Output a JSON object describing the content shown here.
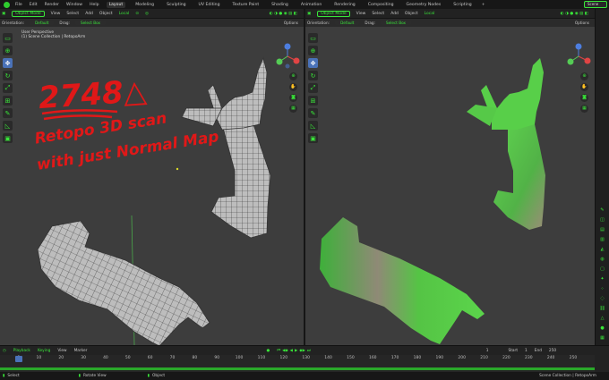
{
  "topbar": {
    "menus": [
      "File",
      "Edit",
      "Render",
      "Window",
      "Help"
    ],
    "workspaces": [
      "Layout",
      "Modeling",
      "Sculpting",
      "UV Editing",
      "Texture Paint",
      "Shading",
      "Animation",
      "Rendering",
      "Compositing",
      "Geometry Nodes",
      "Scripting"
    ],
    "active_workspace": "Layout",
    "add_tab": "+",
    "scene": "Scene"
  },
  "left_view": {
    "header": {
      "mode": "Object Mode",
      "menus": [
        "View",
        "Select",
        "Add",
        "Object"
      ],
      "transform": "Local"
    },
    "options": {
      "orientation_label": "Orientation:",
      "orientation_value": "Default",
      "drag_label": "Drag:",
      "drag_value": "Select Box",
      "options_label": "Options"
    },
    "overlay_title": "User Perspective",
    "overlay_subtitle": "(1) Scene Collection | RetopoArm",
    "annotation": {
      "count": "2748△",
      "line1": "Retopo 3D scan",
      "line2": "with just Normal Map"
    }
  },
  "right_view": {
    "header": {
      "mode": "Object Mode",
      "menus": [
        "View",
        "Select",
        "Add",
        "Object"
      ],
      "transform": "Local"
    },
    "options": {
      "orientation_label": "Orientation:",
      "orientation_value": "Default",
      "drag_label": "Drag:",
      "drag_value": "Select Box",
      "options_label": "Options"
    }
  },
  "timeline": {
    "menus": [
      "Playback",
      "Keying",
      "View",
      "Marker"
    ],
    "current_frame": "1",
    "start_label": "Start",
    "start": "1",
    "end_label": "End",
    "end": "250",
    "ticks": [
      "1",
      "10",
      "20",
      "30",
      "40",
      "50",
      "60",
      "70",
      "80",
      "90",
      "100",
      "110",
      "120",
      "130",
      "140",
      "150",
      "160",
      "170",
      "180",
      "190",
      "200",
      "210",
      "220",
      "230",
      "240",
      "250"
    ]
  },
  "status": {
    "select": "Select",
    "rotate": "Rotate View",
    "object": "Object",
    "info": "Scene Collection | RetopoArm"
  },
  "colors": {
    "accent": "#39e639",
    "viewport_bg": "#3d3d3d",
    "annotation": "#e01818",
    "selected_tool": "#4a72b8"
  },
  "icons": {
    "gizmo": "axis-gizmo",
    "tools": [
      "select-box-icon",
      "cursor-icon",
      "move-icon",
      "rotate-icon",
      "scale-icon",
      "transform-icon",
      "annotate-icon",
      "measure-icon",
      "add-cube-icon"
    ]
  }
}
